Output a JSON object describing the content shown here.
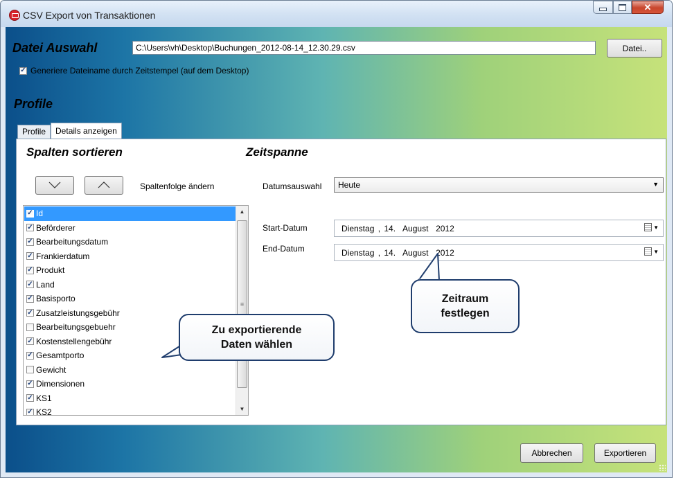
{
  "window": {
    "title": "CSV Export von Transaktionen",
    "icon": "app-mail-icon",
    "controls": [
      "minimize",
      "maximize",
      "close"
    ]
  },
  "file_section": {
    "label": "Datei Auswahl",
    "path_value": "C:\\Users\\vh\\Desktop\\Buchungen_2012-08-14_12.30.29.csv",
    "button_label": "Datei..",
    "generate_checkbox": {
      "label": "Generiere Dateiname durch Zeitstempel (auf dem Desktop)",
      "checked": true
    }
  },
  "profile": {
    "heading": "Profile",
    "tabs": [
      {
        "label": "Profile",
        "active": false
      },
      {
        "label": "Details anzeigen",
        "active": true
      }
    ]
  },
  "columns": {
    "heading": "Spalten sortieren",
    "down_button": "\\/",
    "up_button": "/\\",
    "order_label": "Spaltenfolge ändern",
    "items": [
      {
        "label": "Id",
        "checked": true,
        "selected": true
      },
      {
        "label": "Beförderer",
        "checked": true
      },
      {
        "label": "Bearbeitungsdatum",
        "checked": true
      },
      {
        "label": "Frankierdatum",
        "checked": true
      },
      {
        "label": "Produkt",
        "checked": true
      },
      {
        "label": "Land",
        "checked": true
      },
      {
        "label": "Basisporto",
        "checked": true
      },
      {
        "label": "Zusatzleistungsgebühr",
        "checked": true
      },
      {
        "label": "Bearbeitungsgebuehr",
        "checked": false
      },
      {
        "label": "Kostenstellengebühr",
        "checked": true
      },
      {
        "label": "Gesamtporto",
        "checked": true
      },
      {
        "label": "Gewicht",
        "checked": false
      },
      {
        "label": "Dimensionen",
        "checked": true
      },
      {
        "label": "KS1",
        "checked": true
      },
      {
        "label": "KS2",
        "checked": true
      }
    ]
  },
  "timespan": {
    "heading": "Zeitspanne",
    "date_selection_label": "Datumsauswahl",
    "date_selection_value": "Heute",
    "start_label": "Start-Datum",
    "start_value": "Dienstag , 14.  August  2012",
    "end_label": "End-Datum",
    "end_value": "Dienstag , 14.  August  2012"
  },
  "callouts": {
    "columns": [
      "Zu exportierende",
      "Daten wählen"
    ],
    "timespan": [
      "Zeitraum",
      "festlegen"
    ]
  },
  "footer": {
    "cancel_label": "Abbrechen",
    "export_label": "Exportieren"
  },
  "colors": {
    "selection": "#3399ff",
    "bubble_border": "#1f3d6d",
    "close_button": "#c8452c"
  }
}
